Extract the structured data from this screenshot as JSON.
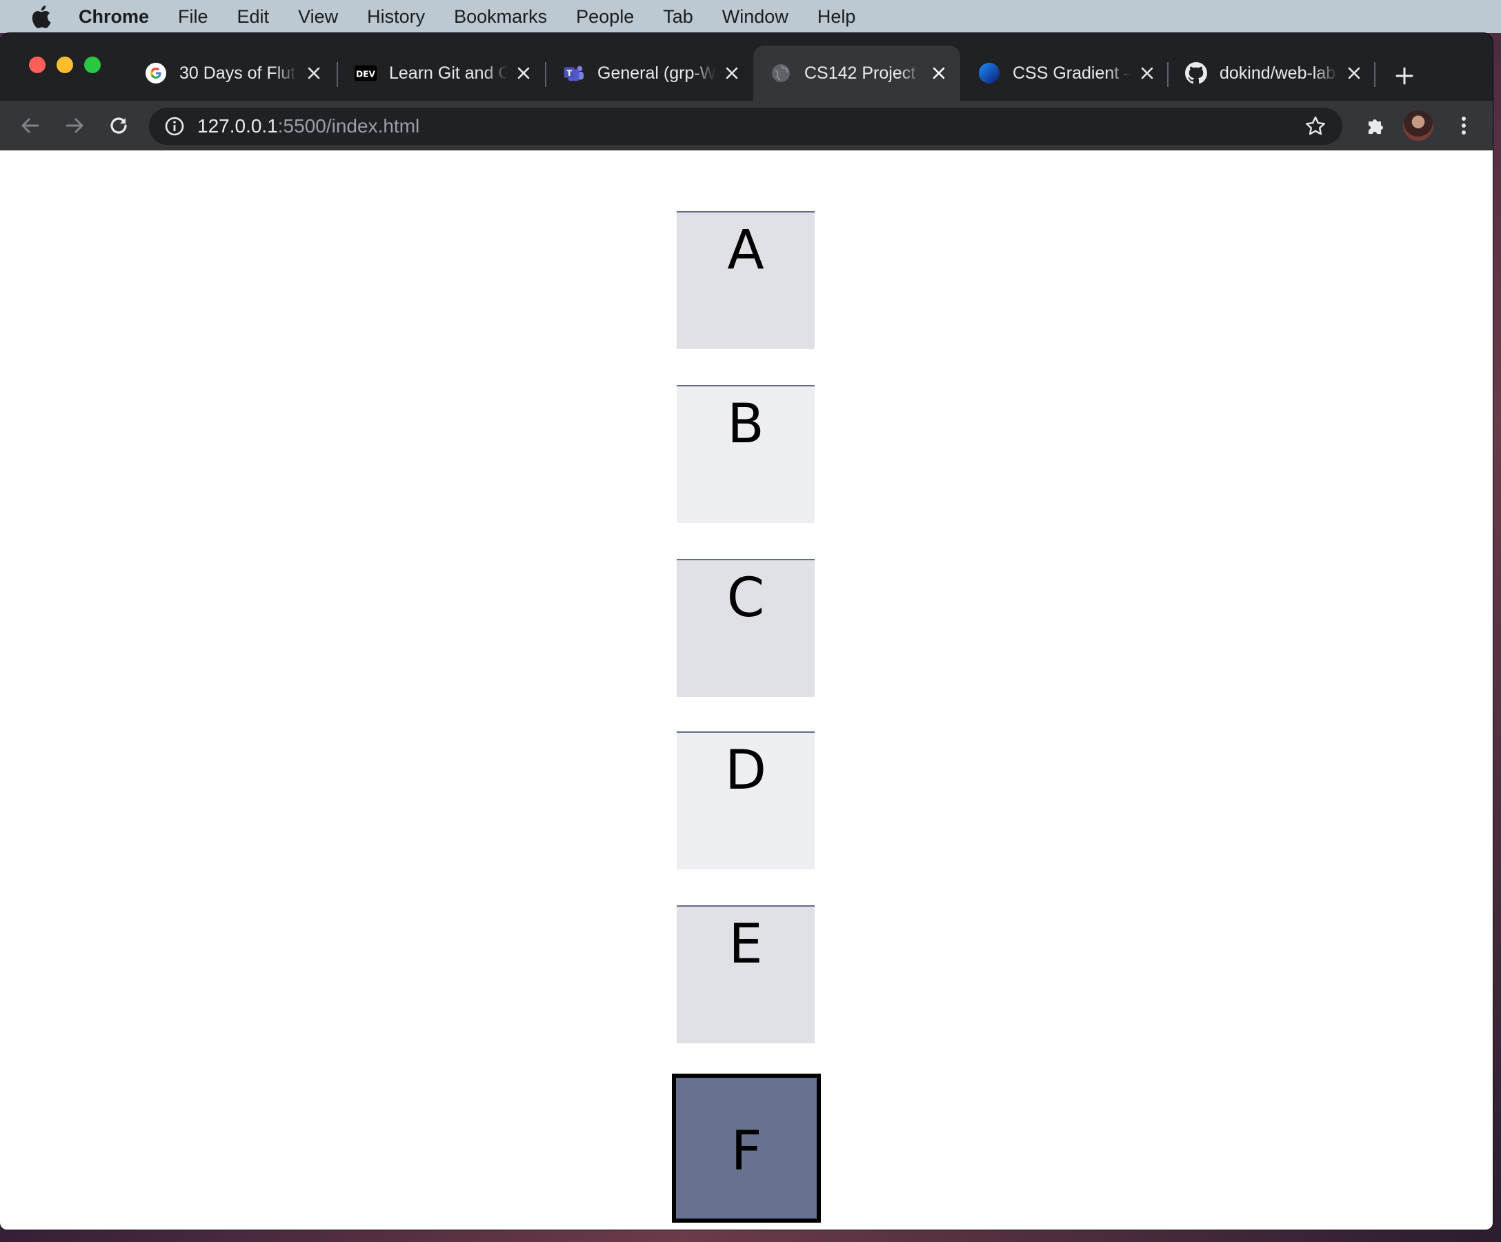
{
  "menubar": {
    "app_name": "Chrome",
    "items": [
      "File",
      "Edit",
      "View",
      "History",
      "Bookmarks",
      "People",
      "Tab",
      "Window",
      "Help"
    ]
  },
  "tabs": [
    {
      "title": "30 Days of Flut",
      "icon": "google-icon",
      "active": false
    },
    {
      "title": "Learn Git and G",
      "icon": "dev-icon",
      "active": false
    },
    {
      "title": "General (grp-W",
      "icon": "teams-icon",
      "active": false
    },
    {
      "title": "CS142 Project",
      "icon": "globe-icon",
      "active": true
    },
    {
      "title": "CSS Gradient –",
      "icon": "gradient-circle-icon",
      "active": false
    },
    {
      "title": "dokind/web-lab",
      "icon": "github-icon",
      "active": false
    }
  ],
  "address_bar": {
    "host": "127.0.0.1",
    "rest": ":5500/index.html"
  },
  "boxes": [
    "A",
    "B",
    "C",
    "D",
    "E",
    "F"
  ],
  "colors": {
    "box_light": "#dfe1e6",
    "box_lighter": "#eceef2",
    "box_active": "#687290",
    "box_top_border": "#636b8b"
  }
}
